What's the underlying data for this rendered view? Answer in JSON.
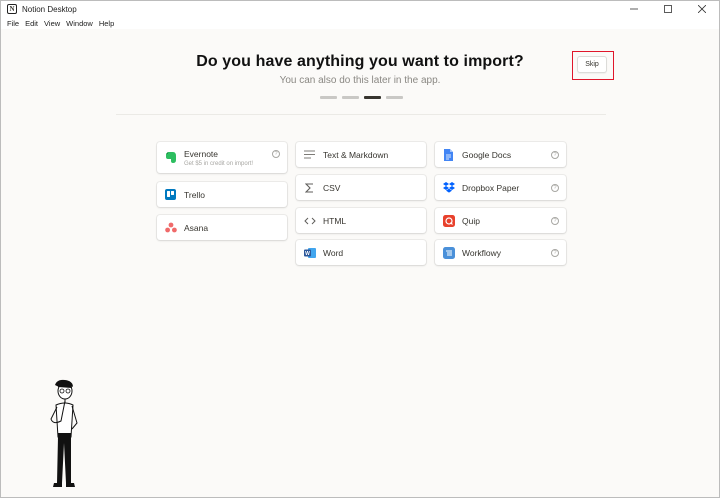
{
  "window": {
    "title": "Notion Desktop",
    "app_icon_glyph": "N"
  },
  "menubar": {
    "items": [
      "File",
      "Edit",
      "View",
      "Window",
      "Help"
    ]
  },
  "main": {
    "heading": "Do you have anything you want to import?",
    "subheading": "You can also do this later in the app.",
    "skip_label": "Skip",
    "steps_total": 4,
    "steps_active_index": 2
  },
  "importers": {
    "col1": [
      {
        "label": "Evernote",
        "sub": "Get $5 in credit on import!",
        "icon": "evernote-icon",
        "help": "?"
      },
      {
        "label": "Trello",
        "icon": "trello-icon"
      },
      {
        "label": "Asana",
        "icon": "asana-icon"
      }
    ],
    "col2": [
      {
        "label": "Text & Markdown",
        "icon": "text-lines-icon"
      },
      {
        "label": "CSV",
        "icon": "sigma-icon"
      },
      {
        "label": "HTML",
        "icon": "code-brackets-icon"
      },
      {
        "label": "Word",
        "icon": "word-icon"
      }
    ],
    "col3": [
      {
        "label": "Google Docs",
        "icon": "google-docs-icon",
        "help": "?"
      },
      {
        "label": "Dropbox Paper",
        "icon": "dropbox-icon",
        "help": "?"
      },
      {
        "label": "Quip",
        "icon": "quip-icon",
        "help": "?"
      },
      {
        "label": "Workflowy",
        "icon": "workflowy-icon",
        "help": "?"
      }
    ]
  },
  "colors": {
    "highlight": "#e0162b",
    "evernote": "#2dbe60",
    "trello": "#0079bf",
    "asana": "#f06a6a",
    "word": "#2b579a",
    "google_docs": "#4285f4",
    "dropbox": "#0061ff",
    "quip": "#e8412c",
    "workflowy": "#4a90d9"
  }
}
